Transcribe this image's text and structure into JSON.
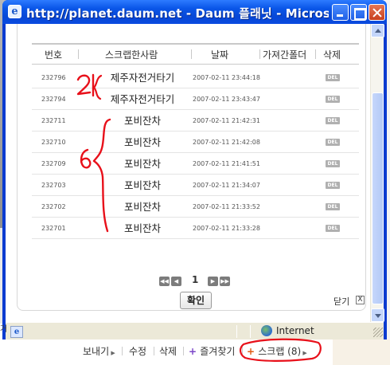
{
  "window": {
    "title": "http://planet.daum.net - Daum 플래닛 - Microsoft In..."
  },
  "table": {
    "headers": [
      "번호",
      "스크랩한사람",
      "날짜",
      "가져간폴더",
      "삭제"
    ],
    "rows": [
      {
        "id": "232796",
        "name": "제주자전거타기",
        "date": "2007-02-11 23:44:18",
        "action": "DEL"
      },
      {
        "id": "232794",
        "name": "제주자전거타기",
        "date": "2007-02-11 23:43:47",
        "action": "DEL"
      },
      {
        "id": "232711",
        "name": "포비잔차",
        "date": "2007-02-11 21:42:31",
        "action": "DEL"
      },
      {
        "id": "232710",
        "name": "포비잔차",
        "date": "2007-02-11 21:42:08",
        "action": "DEL"
      },
      {
        "id": "232709",
        "name": "포비잔차",
        "date": "2007-02-11 21:41:51",
        "action": "DEL"
      },
      {
        "id": "232703",
        "name": "포비잔차",
        "date": "2007-02-11 21:34:07",
        "action": "DEL"
      },
      {
        "id": "232702",
        "name": "포비잔차",
        "date": "2007-02-11 21:33:52",
        "action": "DEL"
      },
      {
        "id": "232701",
        "name": "포비잔차",
        "date": "2007-02-11 21:33:28",
        "action": "DEL"
      }
    ]
  },
  "pager": {
    "current": "1"
  },
  "dialog": {
    "ok_label": "확인",
    "close_label": "닫기",
    "close_glyph": "X"
  },
  "statusbar": {
    "zone": "Internet",
    "left_fragment": "거"
  },
  "bottom_links": {
    "send": "보내기",
    "edit": "수정",
    "delete": "삭제",
    "favorite": "즐겨찾기",
    "scrap": "스크랩 (8)"
  },
  "annotations": {
    "count_2": "2",
    "count_6": "6"
  },
  "colors": {
    "annotation": "#e8101a",
    "titlebar": "#0a56e8"
  }
}
